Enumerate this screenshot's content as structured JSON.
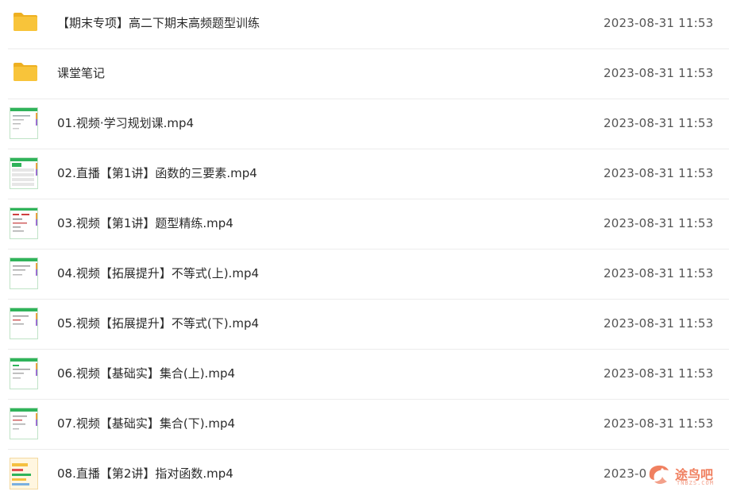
{
  "files": [
    {
      "name": "【期末专项】高二下期末高频题型训练",
      "date": "2023-08-31 11:53",
      "type": "folder",
      "icon": "folder-icon"
    },
    {
      "name": "课堂笔记",
      "date": "2023-08-31 11:53",
      "type": "folder",
      "icon": "folder-icon"
    },
    {
      "name": "01.视频·学习规划课.mp4",
      "date": "2023-08-31 11:53",
      "type": "video",
      "icon": "video-thumbnail-icon"
    },
    {
      "name": "02.直播【第1讲】函数的三要素.mp4",
      "date": "2023-08-31 11:53",
      "type": "video",
      "icon": "video-thumbnail-icon"
    },
    {
      "name": "03.视频【第1讲】题型精练.mp4",
      "date": "2023-08-31 11:53",
      "type": "video",
      "icon": "video-thumbnail-icon"
    },
    {
      "name": "04.视频【拓展提升】不等式(上).mp4",
      "date": "2023-08-31 11:53",
      "type": "video",
      "icon": "video-thumbnail-icon"
    },
    {
      "name": "05.视频【拓展提升】不等式(下).mp4",
      "date": "2023-08-31 11:53",
      "type": "video",
      "icon": "video-thumbnail-icon"
    },
    {
      "name": "06.视频【基础实】集合(上).mp4",
      "date": "2023-08-31 11:53",
      "type": "video",
      "icon": "video-thumbnail-icon"
    },
    {
      "name": "07.视频【基础实】集合(下).mp4",
      "date": "2023-08-31 11:53",
      "type": "video",
      "icon": "video-thumbnail-icon"
    },
    {
      "name": "08.直播【第2讲】指对函数.mp4",
      "date": "2023-0",
      "type": "video",
      "icon": "video-thumbnail-icon"
    }
  ],
  "watermark": {
    "text": "途鸟吧",
    "sub": "TNBZS.COM",
    "icon": "tuniaoba-logo-icon"
  },
  "colors": {
    "folder": "#f8c43a",
    "folder_dark": "#eeb021",
    "thumb_border": "#bfe3c6",
    "accent_green": "#2fb35a",
    "watermark": "#f08060"
  }
}
